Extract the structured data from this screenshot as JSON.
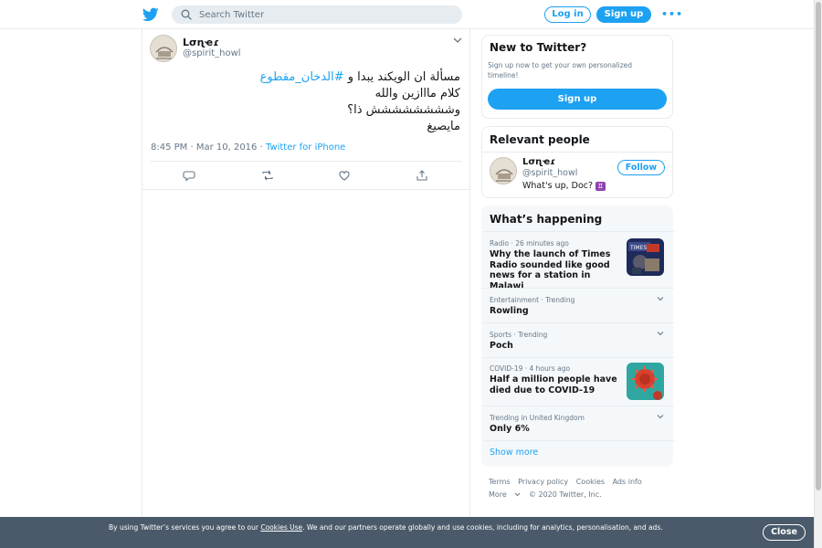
{
  "header": {
    "logo_icon": "twitter-bird-icon",
    "search_placeholder": "Search Twitter",
    "login_label": "Log in",
    "signup_label": "Sign up",
    "more_label": "•••"
  },
  "tweet": {
    "author_name": "Lσɳҽɾ",
    "author_handle": "@spirit_howl",
    "text_line1_prefix": "مسألة ان الويكند يبدا و",
    "text_line1_hashtag": "#الدخان_مقطوع",
    "text_line2": "كلام مااازين والله",
    "text_line3": "وشششششششش ذا؟",
    "text_line4": "مايصيغ",
    "timestamp": "8:45 PM · Mar 10, 2016",
    "separator": " · ",
    "source": "Twitter for iPhone",
    "actions": [
      "reply-icon",
      "retweet-icon",
      "like-icon",
      "share-icon"
    ]
  },
  "sidebar": {
    "new_to_twitter": {
      "title": "New to Twitter?",
      "subtitle": "Sign up now to get your own personalized timeline!",
      "button": "Sign up"
    },
    "relevant_people": {
      "title": "Relevant people",
      "name": "Lσɳҽɾ",
      "handle": "@spirit_howl",
      "bio": "What's up, Doc?",
      "bio_emoji": "♊",
      "follow_label": "Follow"
    },
    "whats_happening": {
      "title": "What’s happening",
      "trends": [
        {
          "context": "Radio · 26 minutes ago",
          "title": "Why the launch of Times Radio sounded like good news for a station in Malawi",
          "has_image": true
        },
        {
          "context": "Entertainment · Trending",
          "title": "Rowling",
          "has_image": false
        },
        {
          "context": "Sports · Trending",
          "title": "Poch",
          "has_image": false
        },
        {
          "context": "COVID-19 · 4 hours ago",
          "title": "Half a million people have died due to COVID-19",
          "has_image": true
        },
        {
          "context": "Trending in United Kingdom",
          "title": "Only 6%",
          "has_image": false
        }
      ],
      "show_more": "Show more"
    },
    "footer": {
      "links": [
        "Terms",
        "Privacy policy",
        "Cookies",
        "Ads info"
      ],
      "more": "More",
      "copyright": "© 2020 Twitter, Inc."
    }
  },
  "cookie_banner": {
    "text_before": "By using Twitter’s services you agree to our ",
    "link": "Cookies Use",
    "text_after": ". We and our partners operate globally and use cookies, including for analytics, personalisation, and ads.",
    "close_label": "Close"
  },
  "colors": {
    "accent": "#1da1f2",
    "text": "#14171a",
    "muted": "#657786",
    "border": "#e6ecf0",
    "banner": "#4a5a6a"
  }
}
